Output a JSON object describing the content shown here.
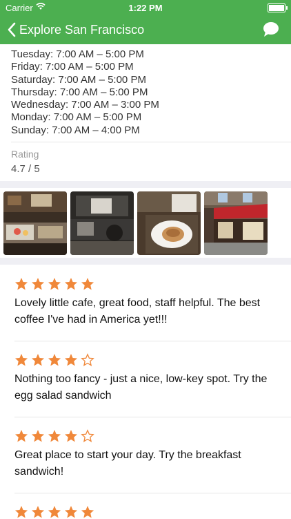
{
  "status_bar": {
    "carrier": "Carrier",
    "time": "1:22 PM"
  },
  "nav": {
    "title": "Explore San Francisco",
    "back_icon": "chevron-left-icon",
    "chat_icon": "chat-bubble-icon"
  },
  "hours": [
    "Tuesday: 7:00 AM – 5:00 PM",
    "Friday: 7:00 AM – 5:00 PM",
    "Saturday: 7:00 AM – 5:00 PM",
    "Thursday: 7:00 AM – 5:00 PM",
    "Wednesday: 7:00 AM – 3:00 PM",
    "Monday: 7:00 AM – 5:00 PM",
    "Sunday: 7:00 AM – 4:00 PM"
  ],
  "rating": {
    "label": "Rating",
    "value": "4.7 / 5"
  },
  "reviews": [
    {
      "stars": 5,
      "text": "Lovely little cafe, great food, staff helpful. The best coffee I've had in America yet!!!"
    },
    {
      "stars": 4,
      "text": "Nothing too fancy - just a nice, low-key spot. Try the egg salad sandwich"
    },
    {
      "stars": 4,
      "text": "Great place to start your day. Try the breakfast sandwich!"
    },
    {
      "stars": 5,
      "text": ""
    }
  ],
  "colors": {
    "header": "#4caf50",
    "star": "#f0883a",
    "divider": "#efeff4"
  }
}
